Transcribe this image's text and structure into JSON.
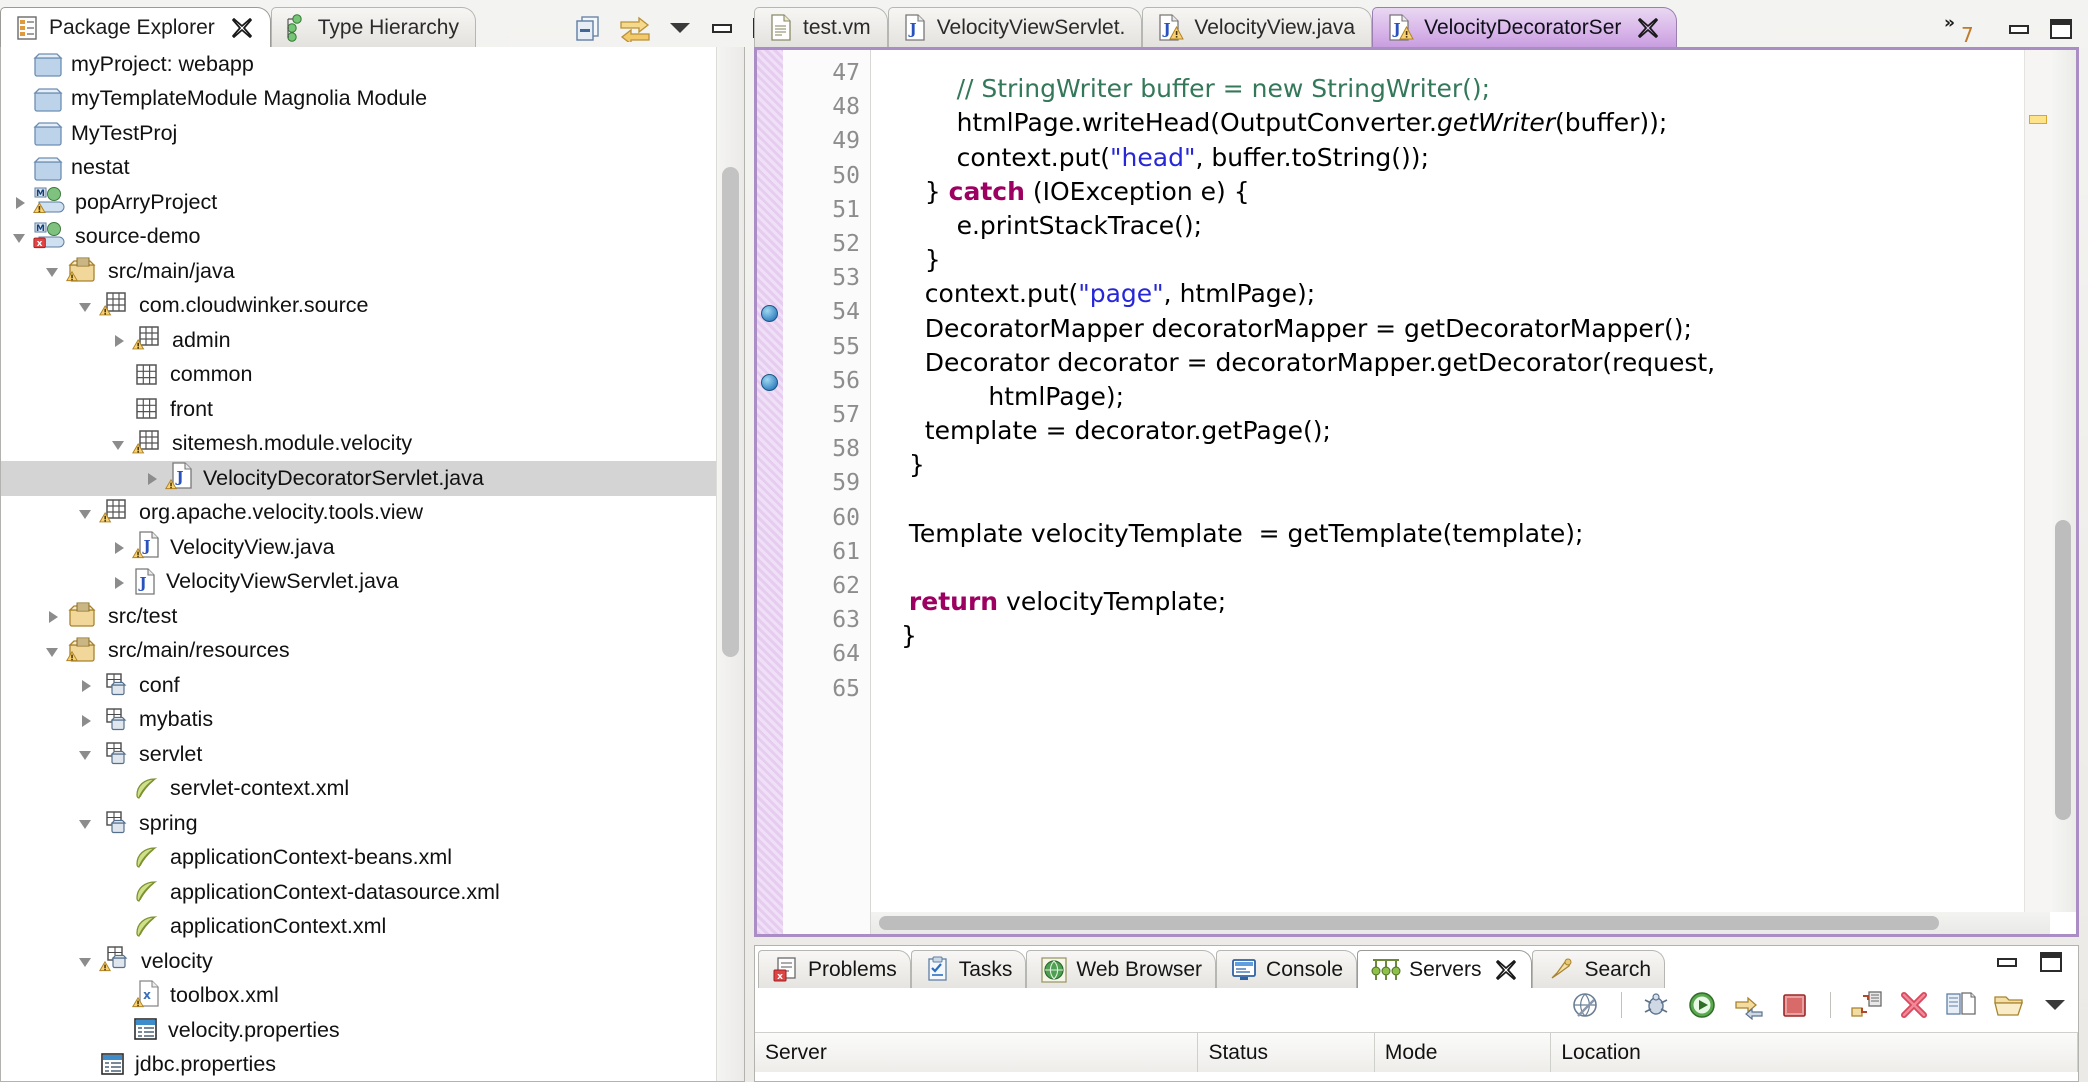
{
  "explorer": {
    "tabs": [
      {
        "label": "Package Explorer",
        "icon": "package-explorer-icon",
        "active": true,
        "closable": true
      },
      {
        "label": "Type Hierarchy",
        "icon": "type-hierarchy-icon",
        "active": false,
        "closable": false
      }
    ],
    "toolbar": [
      {
        "name": "collapse-all-icon",
        "title": "Collapse All"
      },
      {
        "name": "link-with-editor-icon",
        "title": "Link with Editor"
      },
      {
        "name": "view-menu-icon",
        "title": "View Menu"
      },
      {
        "name": "minimize-icon",
        "title": "Minimize"
      },
      {
        "name": "maximize-icon",
        "title": "Maximize"
      }
    ],
    "tree": [
      {
        "label": "myProject: webapp",
        "indent": 0,
        "twisty": "none",
        "icon": "folder-icon"
      },
      {
        "label": "myTemplateModule Magnolia Module",
        "indent": 0,
        "twisty": "none",
        "icon": "folder-icon"
      },
      {
        "label": "MyTestProj",
        "indent": 0,
        "twisty": "none",
        "icon": "folder-icon"
      },
      {
        "label": "nestat",
        "indent": 0,
        "twisty": "none",
        "icon": "folder-icon"
      },
      {
        "label": "popArryProject",
        "indent": 0,
        "twisty": "closed",
        "icon": "maven-project-warning-icon"
      },
      {
        "label": "source-demo",
        "indent": 0,
        "twisty": "open",
        "icon": "maven-project-error-icon"
      },
      {
        "label": "src/main/java",
        "indent": 1,
        "twisty": "open",
        "icon": "source-folder-icon"
      },
      {
        "label": "com.cloudwinker.source",
        "indent": 2,
        "twisty": "open",
        "icon": "package-warning-icon"
      },
      {
        "label": "admin",
        "indent": 3,
        "twisty": "closed",
        "icon": "package-warning-icon"
      },
      {
        "label": "common",
        "indent": 3,
        "twisty": "none",
        "icon": "package-empty-icon"
      },
      {
        "label": "front",
        "indent": 3,
        "twisty": "none",
        "icon": "package-empty-icon"
      },
      {
        "label": "sitemesh.module.velocity",
        "indent": 3,
        "twisty": "open",
        "icon": "package-warning-icon"
      },
      {
        "label": "VelocityDecoratorServlet.java",
        "indent": 4,
        "twisty": "closed",
        "icon": "java-file-warning-icon",
        "selected": true
      },
      {
        "label": "org.apache.velocity.tools.view",
        "indent": 2,
        "twisty": "open",
        "icon": "package-warning-icon"
      },
      {
        "label": "VelocityView.java",
        "indent": 3,
        "twisty": "closed",
        "icon": "java-file-warning-icon"
      },
      {
        "label": "VelocityViewServlet.java",
        "indent": 3,
        "twisty": "closed",
        "icon": "java-file-icon"
      },
      {
        "label": "src/test",
        "indent": 1,
        "twisty": "closed",
        "icon": "source-folder-plain-icon"
      },
      {
        "label": "src/main/resources",
        "indent": 1,
        "twisty": "open",
        "icon": "source-folder-icon"
      },
      {
        "label": "conf",
        "indent": 2,
        "twisty": "closed",
        "icon": "resource-folder-icon"
      },
      {
        "label": "mybatis",
        "indent": 2,
        "twisty": "closed",
        "icon": "resource-folder-icon"
      },
      {
        "label": "servlet",
        "indent": 2,
        "twisty": "open",
        "icon": "resource-folder-icon"
      },
      {
        "label": "servlet-context.xml",
        "indent": 3,
        "twisty": "none",
        "icon": "spring-xml-icon"
      },
      {
        "label": "spring",
        "indent": 2,
        "twisty": "open",
        "icon": "resource-folder-icon"
      },
      {
        "label": "applicationContext-beans.xml",
        "indent": 3,
        "twisty": "none",
        "icon": "spring-xml-icon"
      },
      {
        "label": "applicationContext-datasource.xml",
        "indent": 3,
        "twisty": "none",
        "icon": "spring-xml-icon"
      },
      {
        "label": "applicationContext.xml",
        "indent": 3,
        "twisty": "none",
        "icon": "spring-xml-icon"
      },
      {
        "label": "velocity",
        "indent": 2,
        "twisty": "open",
        "icon": "resource-folder-warning-icon"
      },
      {
        "label": "toolbox.xml",
        "indent": 3,
        "twisty": "none",
        "icon": "xml-file-warning-icon"
      },
      {
        "label": "velocity.properties",
        "indent": 3,
        "twisty": "none",
        "icon": "properties-file-icon"
      },
      {
        "label": "jdbc.properties",
        "indent": 2,
        "twisty": "none",
        "icon": "properties-file-icon"
      }
    ]
  },
  "editor": {
    "tabs": [
      {
        "label": "test.vm",
        "icon": "velocity-file-icon",
        "active": false,
        "closable": false,
        "warning": false
      },
      {
        "label": "VelocityViewServlet.",
        "icon": "java-file-icon",
        "active": false,
        "closable": false,
        "warning": false
      },
      {
        "label": "VelocityView.java",
        "icon": "java-file-icon",
        "active": false,
        "closable": false,
        "warning": true
      },
      {
        "label": "VelocityDecoratorSer",
        "icon": "java-file-icon",
        "active": true,
        "closable": true,
        "warning": true
      }
    ],
    "overflow_label": "7",
    "overflow_icon": "chevron-more-icon",
    "window_controls": [
      {
        "name": "minimize-icon",
        "title": "Minimize"
      },
      {
        "name": "maximize-icon",
        "title": "Maximize"
      }
    ],
    "first_line": 47,
    "last_line": 65,
    "markers": [
      54,
      56
    ],
    "lines": [
      {
        "n": 47,
        "tokens": []
      },
      {
        "n": 48,
        "tokens": [
          {
            "t": "        ",
            "c": ""
          },
          {
            "t": "// StringWriter buffer = new StringWriter();",
            "c": "cm"
          }
        ]
      },
      {
        "n": 49,
        "tokens": [
          {
            "t": "        htmlPage.writeHead(OutputConverter.",
            "c": ""
          },
          {
            "t": "getWriter",
            "c": "it"
          },
          {
            "t": "(buffer));",
            "c": ""
          }
        ]
      },
      {
        "n": 50,
        "tokens": [
          {
            "t": "        context.put(",
            "c": ""
          },
          {
            "t": "\"head\"",
            "c": "s"
          },
          {
            "t": ", buffer.toString());",
            "c": ""
          }
        ]
      },
      {
        "n": 51,
        "tokens": [
          {
            "t": "    } ",
            "c": ""
          },
          {
            "t": "catch",
            "c": "k"
          },
          {
            "t": " (IOException e) {",
            "c": ""
          }
        ]
      },
      {
        "n": 52,
        "tokens": [
          {
            "t": "        e.printStackTrace();",
            "c": ""
          }
        ]
      },
      {
        "n": 53,
        "tokens": [
          {
            "t": "    }",
            "c": ""
          }
        ]
      },
      {
        "n": 54,
        "tokens": [
          {
            "t": "    context.put(",
            "c": ""
          },
          {
            "t": "\"page\"",
            "c": "s"
          },
          {
            "t": ", htmlPage);",
            "c": ""
          }
        ]
      },
      {
        "n": 55,
        "tokens": [
          {
            "t": "    DecoratorMapper decoratorMapper = getDecoratorMapper();",
            "c": ""
          }
        ]
      },
      {
        "n": 56,
        "tokens": [
          {
            "t": "    Decorator decorator = decoratorMapper.getDecorator(request,",
            "c": ""
          }
        ]
      },
      {
        "n": 57,
        "tokens": [
          {
            "t": "            htmlPage);",
            "c": ""
          }
        ]
      },
      {
        "n": 58,
        "tokens": [
          {
            "t": "    template = decorator.getPage();",
            "c": ""
          }
        ]
      },
      {
        "n": 59,
        "tokens": [
          {
            "t": "  }",
            "c": ""
          }
        ]
      },
      {
        "n": 60,
        "tokens": []
      },
      {
        "n": 61,
        "tokens": [
          {
            "t": "  Template velocityTemplate  = getTemplate(template);",
            "c": ""
          }
        ]
      },
      {
        "n": 62,
        "tokens": []
      },
      {
        "n": 63,
        "tokens": [
          {
            "t": "  ",
            "c": ""
          },
          {
            "t": "return",
            "c": "k"
          },
          {
            "t": " velocityTemplate;",
            "c": ""
          }
        ]
      },
      {
        "n": 64,
        "tokens": [
          {
            "t": " }",
            "c": ""
          }
        ]
      },
      {
        "n": 65,
        "tokens": []
      }
    ]
  },
  "bottom_panel": {
    "tabs": [
      {
        "label": "Problems",
        "icon": "problems-icon",
        "active": false,
        "closable": false
      },
      {
        "label": "Tasks",
        "icon": "tasks-icon",
        "active": false,
        "closable": false
      },
      {
        "label": "Web Browser",
        "icon": "web-browser-icon",
        "active": false,
        "closable": false
      },
      {
        "label": "Console",
        "icon": "console-icon",
        "active": false,
        "closable": false
      },
      {
        "label": "Servers",
        "icon": "servers-icon",
        "active": true,
        "closable": true
      },
      {
        "label": "Search",
        "icon": "search-icon",
        "active": false,
        "closable": false
      }
    ],
    "toolbar": [
      {
        "name": "publish-globe-icon",
        "title": "Publish to Server"
      },
      {
        "name": "debug-server-icon",
        "title": "Start the server in debug mode"
      },
      {
        "name": "start-server-icon",
        "title": "Start the server"
      },
      {
        "name": "profile-server-icon",
        "title": "Start the server in profiling mode"
      },
      {
        "name": "stop-server-icon",
        "title": "Stop the server"
      },
      {
        "name": "publish-module-icon",
        "title": "Publish"
      },
      {
        "name": "remove-server-icon",
        "title": "Remove"
      },
      {
        "name": "add-module-icon",
        "title": "Add and Remove"
      },
      {
        "name": "open-server-icon",
        "title": "Open"
      },
      {
        "name": "view-menu-icon",
        "title": "View Menu"
      }
    ],
    "columns": [
      "Server",
      "Status",
      "Mode",
      "Location"
    ],
    "window_controls": [
      {
        "name": "minimize-icon",
        "title": "Minimize"
      },
      {
        "name": "maximize-icon",
        "title": "Maximize"
      }
    ],
    "rows": []
  }
}
